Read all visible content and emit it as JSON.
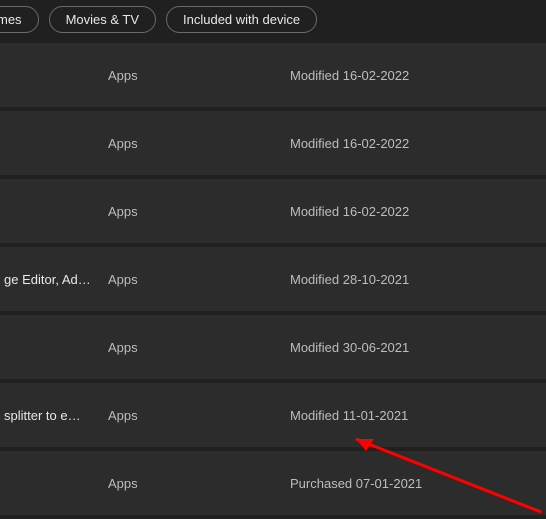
{
  "filters": {
    "items": [
      {
        "label": "mes"
      },
      {
        "label": "Movies & TV"
      },
      {
        "label": "Included with device"
      }
    ]
  },
  "list": {
    "rows": [
      {
        "title": "",
        "category": "Apps",
        "status": "Modified 16-02-2022"
      },
      {
        "title": "",
        "category": "Apps",
        "status": "Modified 16-02-2022"
      },
      {
        "title": "",
        "category": "Apps",
        "status": "Modified 16-02-2022"
      },
      {
        "title": "ge Editor, Ad…",
        "category": "Apps",
        "status": "Modified 28-10-2021"
      },
      {
        "title": "",
        "category": "Apps",
        "status": "Modified 30-06-2021"
      },
      {
        "title": "splitter to e…",
        "category": "Apps",
        "status": "Modified 11-01-2021"
      },
      {
        "title": "",
        "category": "Apps",
        "status": "Purchased 07-01-2021"
      }
    ]
  }
}
